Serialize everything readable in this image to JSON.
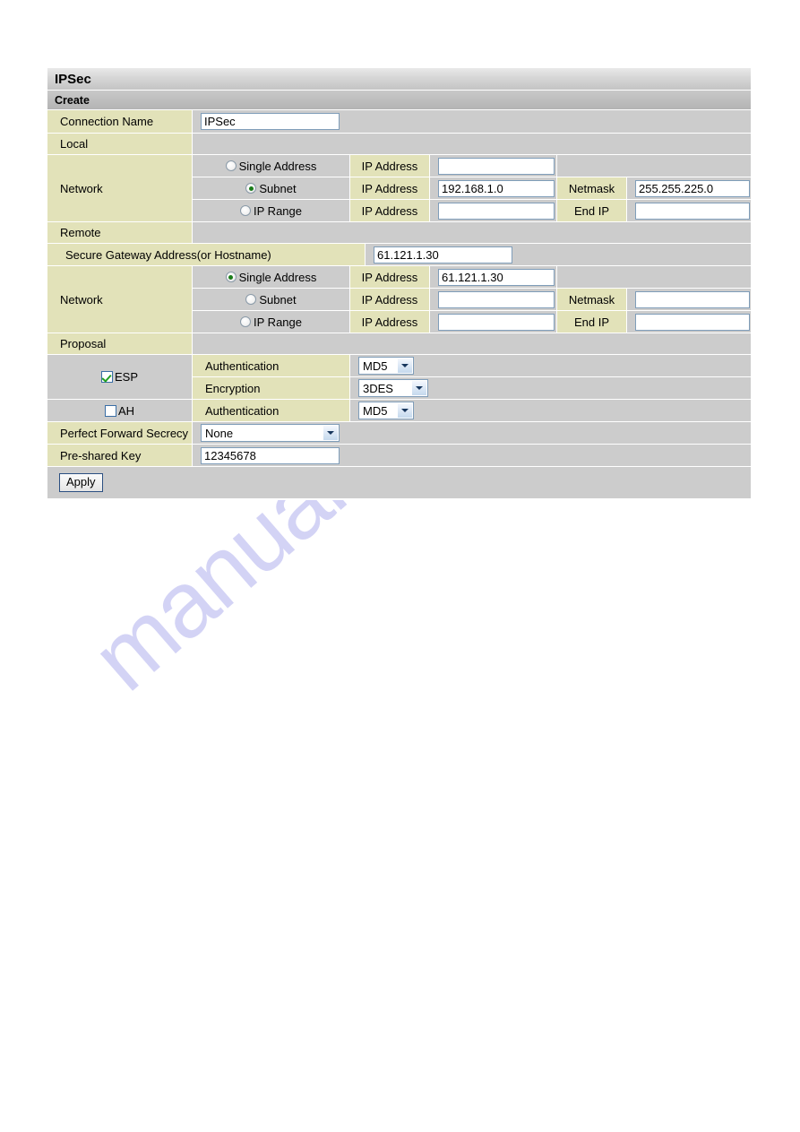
{
  "page": {
    "title": "IPSec",
    "section": "Create",
    "watermark": "manualshive.com",
    "accent_label_bg": "#e2e2b9",
    "accent_value_bg": "#cccccc",
    "input_border": "#7f9db9"
  },
  "connection": {
    "label": "Connection Name",
    "value": "IPSec"
  },
  "local": {
    "label": "Local",
    "network_label": "Network",
    "options": [
      {
        "name": "single-address",
        "label": "Single Address",
        "selected": false,
        "ip_label": "IP Address",
        "ip_value": "",
        "second_label": "",
        "second_value": ""
      },
      {
        "name": "subnet",
        "label": "Subnet",
        "selected": true,
        "ip_label": "IP Address",
        "ip_value": "192.168.1.0",
        "second_label": "Netmask",
        "second_value": "255.255.225.0"
      },
      {
        "name": "ip-range",
        "label": "IP Range",
        "selected": false,
        "ip_label": "IP Address",
        "ip_value": "",
        "second_label": "End IP",
        "second_value": ""
      }
    ]
  },
  "remote": {
    "label": "Remote",
    "gateway_label": "Secure Gateway Address(or Hostname)",
    "gateway_value": "61.121.1.30",
    "network_label": "Network",
    "options": [
      {
        "name": "single-address",
        "label": "Single Address",
        "selected": true,
        "ip_label": "IP Address",
        "ip_value": "61.121.1.30",
        "second_label": "",
        "second_value": ""
      },
      {
        "name": "subnet",
        "label": "Subnet",
        "selected": false,
        "ip_label": "IP Address",
        "ip_value": "",
        "second_label": "Netmask",
        "second_value": ""
      },
      {
        "name": "ip-range",
        "label": "IP Range",
        "selected": false,
        "ip_label": "IP Address",
        "ip_value": "",
        "second_label": "End IP",
        "second_value": ""
      }
    ]
  },
  "proposal": {
    "label": "Proposal",
    "esp": {
      "label": "ESP",
      "checked": true,
      "authentication_label": "Authentication",
      "authentication_value": "MD5",
      "encryption_label": "Encryption",
      "encryption_value": "3DES"
    },
    "ah": {
      "label": "AH",
      "checked": false,
      "authentication_label": "Authentication",
      "authentication_value": "MD5"
    }
  },
  "pfs": {
    "label": "Perfect Forward Secrecy",
    "value": "None"
  },
  "psk": {
    "label": "Pre-shared Key",
    "value": "12345678"
  },
  "actions": {
    "apply_label": "Apply"
  }
}
